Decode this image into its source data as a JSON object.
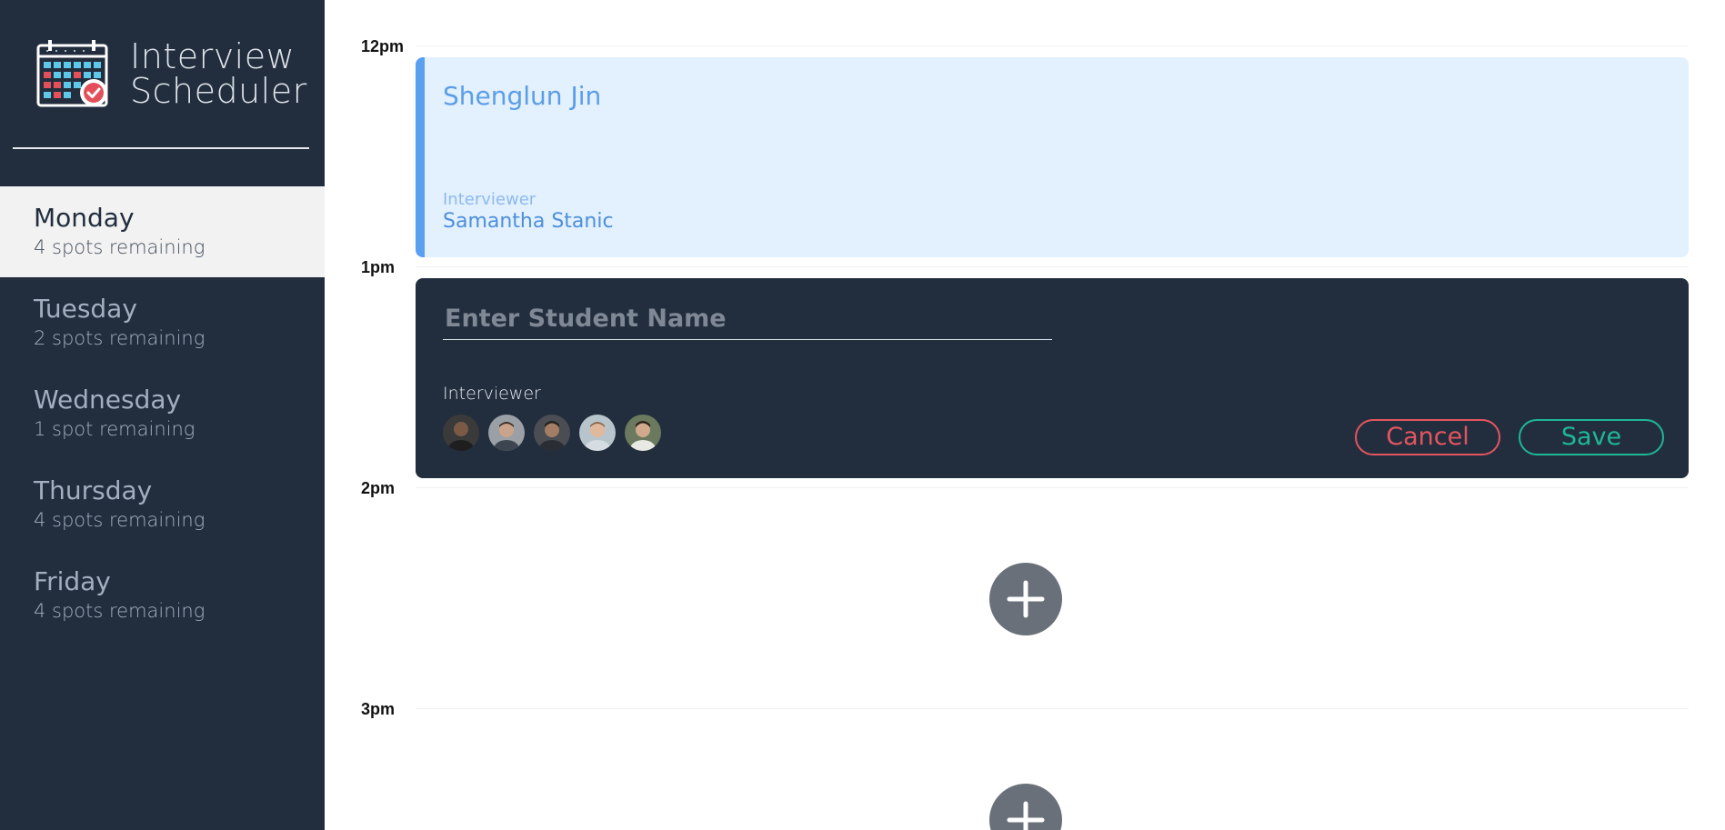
{
  "app": {
    "title_line1": "Interview",
    "title_line2": "Scheduler"
  },
  "sidebar": {
    "days": [
      {
        "name": "Monday",
        "spots": "4 spots remaining",
        "selected": true
      },
      {
        "name": "Tuesday",
        "spots": "2 spots remaining",
        "selected": false
      },
      {
        "name": "Wednesday",
        "spots": "1 spot remaining",
        "selected": false
      },
      {
        "name": "Thursday",
        "spots": "4 spots remaining",
        "selected": false
      },
      {
        "name": "Friday",
        "spots": "4 spots remaining",
        "selected": false
      }
    ]
  },
  "schedule": {
    "times": [
      "12pm",
      "1pm",
      "2pm",
      "3pm"
    ],
    "booked": {
      "student": "Shenglun Jin",
      "interviewer_label": "Interviewer",
      "interviewer": "Samantha Stanic"
    },
    "form": {
      "placeholder": "Enter Student Name",
      "interviewer_label": "Interviewer",
      "cancel_label": "Cancel",
      "save_label": "Save"
    }
  },
  "colors": {
    "sidebar_bg": "#222e3e",
    "booked_bg": "#e3f0fd",
    "booked_accent": "#5aa0f0",
    "cancel": "#e5555f",
    "save": "#1fb794",
    "add_button": "#6a7079"
  }
}
